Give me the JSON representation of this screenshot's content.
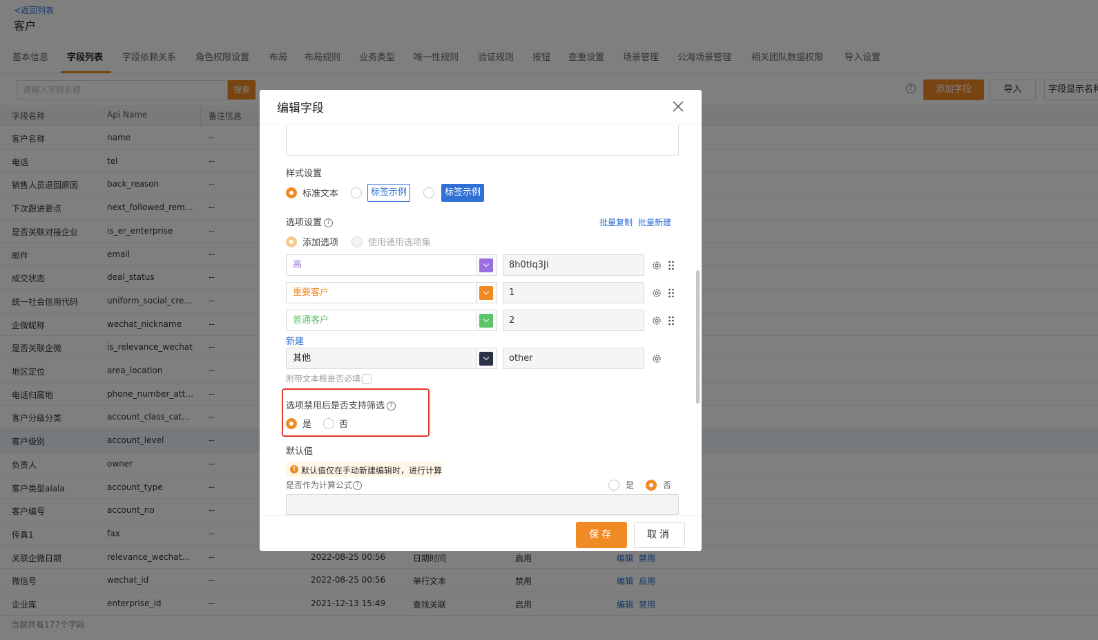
{
  "header": {
    "back_link": "<返回列表",
    "title": "客户"
  },
  "tabs": [
    {
      "label": "基本信息"
    },
    {
      "label": "字段列表"
    },
    {
      "label": "字段依赖关系"
    },
    {
      "label": "角色权限设置"
    },
    {
      "label": "布局"
    },
    {
      "label": "布局规则"
    },
    {
      "label": "业务类型"
    },
    {
      "label": "唯一性规则"
    },
    {
      "label": "验证规则"
    },
    {
      "label": "按钮"
    },
    {
      "label": "查重设置"
    },
    {
      "label": "场景管理"
    },
    {
      "label": "公海场景管理"
    },
    {
      "label": "相关团队数据权限"
    },
    {
      "label": "导入设置"
    }
  ],
  "active_tab": "字段列表",
  "toolbar": {
    "search_placeholder": "请输入字段名称",
    "search_button": "搜索",
    "help": "?",
    "add_field": "添加字段",
    "import": "导入",
    "display_name": "字段显示名称"
  },
  "table": {
    "columns": [
      "字段名称",
      "Api Name",
      "备注信息"
    ],
    "rows": [
      {
        "name": "客户名称",
        "api": "name",
        "note": "--"
      },
      {
        "name": "电话",
        "api": "tel",
        "note": "--"
      },
      {
        "name": "销售人员退回原因",
        "api": "back_reason",
        "note": "--"
      },
      {
        "name": "下次跟进要点",
        "api": "next_followed_remark",
        "note": "--"
      },
      {
        "name": "是否关联对接企业",
        "api": "is_er_enterprise",
        "note": "--"
      },
      {
        "name": "邮件",
        "api": "email",
        "note": "--"
      },
      {
        "name": "成交状态",
        "api": "deal_status",
        "note": "--"
      },
      {
        "name": "统一社会信用代码",
        "api": "uniform_social_credit…",
        "note": "--"
      },
      {
        "name": "企微昵称",
        "api": "wechat_nickname",
        "note": "--"
      },
      {
        "name": "是否关联企微",
        "api": "is_relevance_wechat",
        "note": "--"
      },
      {
        "name": "地区定位",
        "api": "area_location",
        "note": "--"
      },
      {
        "name": "电话归属地",
        "api": "phone_number_attrib…",
        "note": "--"
      },
      {
        "name": "客户分级分类",
        "api": "account_class_categ…",
        "note": "--"
      },
      {
        "name": "客户级别",
        "api": "account_level",
        "note": "--"
      },
      {
        "name": "负责人",
        "api": "owner",
        "note": "--"
      },
      {
        "name": "客户类型alala",
        "api": "account_type",
        "note": "--"
      },
      {
        "name": "客户编号",
        "api": "account_no",
        "note": "--"
      },
      {
        "name": "传真1",
        "api": "fax",
        "note": "--"
      },
      {
        "name": "关联企微日期",
        "api": "relevance_wechat_date",
        "note": "--",
        "time": "2022-08-25 00:56",
        "type": "日期时间",
        "status": "启用",
        "edit": "编辑",
        "toggle": "禁用"
      },
      {
        "name": "微信号",
        "api": "wechat_id",
        "note": "--",
        "time": "2022-08-25 00:56",
        "type": "单行文本",
        "status": "禁用",
        "edit": "编辑",
        "toggle": "启用"
      },
      {
        "name": "企业库",
        "api": "enterprise_id",
        "note": "--",
        "time": "2021-12-13 15:49",
        "type": "查找关联",
        "status": "启用",
        "edit": "编辑",
        "toggle": "禁用"
      }
    ],
    "footer": "当前共有177个字段"
  },
  "modal": {
    "title": "编辑字段",
    "style_label": "样式设置",
    "style_options": [
      "标准文本",
      "标签示例",
      "标签示例"
    ],
    "options_label": "选项设置",
    "batch_copy": "批量复制",
    "batch_new": "批量新建",
    "add_option": "添加选项",
    "use_common_set": "使用通用选项集",
    "options": [
      {
        "label": "高",
        "color": "#9b6fe0",
        "value": "8h0tlq3Ji"
      },
      {
        "label": "重要客户",
        "color": "#f08a24",
        "value": "1"
      },
      {
        "label": "普通客户",
        "color": "#5cc56a",
        "value": "2"
      }
    ],
    "new_link": "新建",
    "other_option": {
      "label": "其他",
      "color": "#2b3247",
      "value": "other"
    },
    "attach_required": "附带文本框是否必填:",
    "filter_label": "选项禁用后是否支持筛选",
    "yes": "是",
    "no": "否",
    "default_label": "默认值",
    "default_warning": "默认值仅在手动新建编辑时，进行计算",
    "formula_label": "是否作为计算公式",
    "save": "保存",
    "cancel": "取消"
  }
}
